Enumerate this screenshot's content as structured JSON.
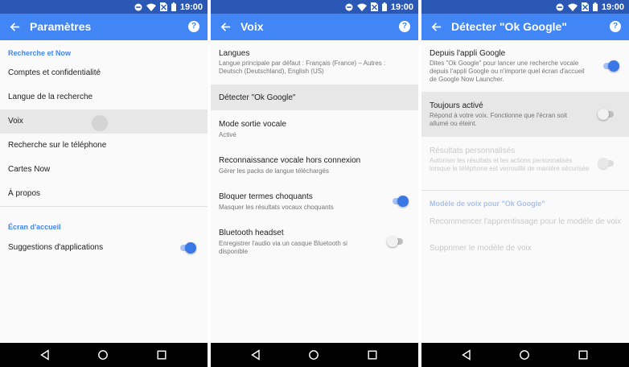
{
  "status": {
    "time": "19:00"
  },
  "colors": {
    "appbar": "#4285f4",
    "statusbar": "#2a58b4",
    "accent": "#4285f4",
    "toggle_on": "#3b78e7"
  },
  "icons": {
    "back": "arrow-back-icon",
    "help": "help-icon",
    "nav_back": "nav-back-icon",
    "nav_home": "nav-home-icon",
    "nav_recent": "nav-recent-icon"
  },
  "help_symbol": "?",
  "screens": {
    "parametres": {
      "title": "Paramètres",
      "section1": "Recherche et Now",
      "items": [
        "Comptes et confidentialité",
        "Langue de la recherche",
        "Voix",
        "Recherche sur le téléphone",
        "Cartes Now",
        "À propos"
      ],
      "section2": "Écran d'accueil",
      "suggestions": {
        "label": "Suggestions d'applications",
        "on": true
      }
    },
    "voix": {
      "title": "Voix",
      "langues": {
        "label": "Langues",
        "sub": "Langue principale par défaut : Français (France) – Autres : Deutsch (Deutschland), English (US)"
      },
      "detecter": {
        "label": "Détecter \"Ok Google\""
      },
      "mode": {
        "label": "Mode sortie vocale",
        "sub": "Activé"
      },
      "reco": {
        "label": "Reconnaissance vocale hors connexion",
        "sub": "Gérer les packs de langue téléchargés"
      },
      "bloquer": {
        "label": "Bloquer termes choquants",
        "sub": "Masquer les résultats vocaux choquants",
        "on": true
      },
      "bluetooth": {
        "label": "Bluetooth headset",
        "sub": "Enregistrer l'audio via un casque Bluetooth si disponible",
        "on": false
      }
    },
    "okgoogle": {
      "title": "Détecter \"Ok Google\"",
      "depuis": {
        "label": "Depuis l'appli Google",
        "sub": "Dites \"Ok Google\" pour lancer une recherche vocale depuis l'appli Google ou n'importe quel écran d'accueil de Google Now Launcher.",
        "on": true
      },
      "toujours": {
        "label": "Toujours activé",
        "sub": "Répond à votre voix. Fonctionne que l'écran soit allumé ou éteint.",
        "on": false
      },
      "resultats": {
        "label": "Résultats personnalisés",
        "sub": "Autoriser les résultats et les actions personnalisés lorsque le téléphone est verrouillé de manière sécurisée",
        "on": false,
        "disabled": true
      },
      "section": "Modèle de voix pour \"Ok Google\"",
      "recommencer": "Recommencer l'apprentissage pour le modèle de voix",
      "supprimer": "Supprimer le modèle de voix"
    }
  }
}
